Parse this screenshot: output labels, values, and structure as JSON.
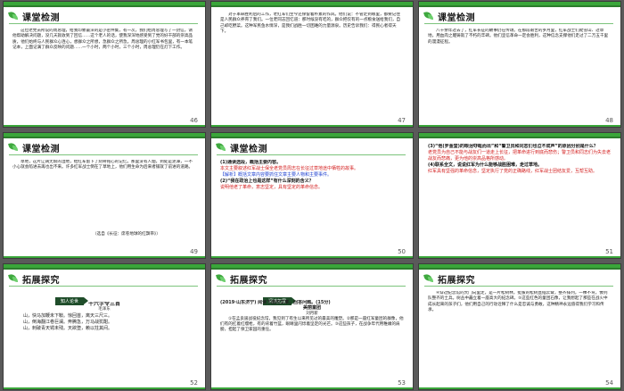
{
  "slides": [
    {
      "title": "课堂检测",
      "page": "46",
      "text": "这位老党员所说的周总理，给我印象最深的是小密件集，有一次，我们给周总理写了一封信，请他帮助解决问题，没几天就收到了回信……这个老人的话，使我深深地感受到了党的好干部的崇高品质，他们始终与人民群众心连心，想群众之所想，急群众之所急。周总理的小红军书包里，有一本笔记本，上面记满了群众反映的问题……一个小时，两个小时，三个小时，周总理仍在灯下工作。"
    },
    {
      "title": "",
      "page": "47",
      "text": "对于革命胜利后的工作，老红军们至今还保留着朴素的作风。他们说：不管走到哪里，都要记住是人民群众养育了我们。一位老同志回忆道：那时候没有吃的，群众把仅有的一点粮食送给我们，自己却吃野菜。这种军民鱼水情深，是我们战胜一切困难的力量源泉。历史告诉我们：得民心者得天下。"
    },
    {
      "title": "课堂检测",
      "page": "48",
      "text": "八十余年过去了，红军长征的故事仍在传颂。在那段艰苦的岁月里，红军战士们爬雪山、过草地，用血肉之躯铸就了不朽的丰碑。他们坚信革命一定会胜利，这种信念支撑他们走过了二万五千里的漫漫征程。"
    },
    {
      "title": "课堂检测",
      "page": "49",
      "text": "草地，这片辽阔无垠的湿地，给红军留下了刻骨铭心的记忆。那里没有人烟，到处是泥潭，一不小心就会陷进去再也出不来。许多红军战士倒在了草地上，他们用生命为后来者铺就了前进的道路。",
      "source": "（选自《长征：席卷地球的红飘带》）"
    },
    {
      "title": "课堂检测",
      "page": "50",
      "q1": "(1)通读选段，概括主要内容。",
      "a1": "本文主要叙述红军战士保全老党员周志在长征过草地途中牺牲的故事。",
      "a1b": "【解析】概括文章内容要抓住文章主要人物和主要事件。",
      "q2": "(2)“我在政治上也是这样”有什么深刻的含义？",
      "a2": "说明他老了革命，意志坚定，具有坚定的革命信念。"
    },
    {
      "title": "",
      "page": "51",
      "q3": "(3)“他(罗金堂)的眼泪夺眶而出”和“警卫员和同志们也泣不成声”的原因分别是什么？",
      "a3": "老党员为自己不能与战友们一道走上长征，把革命进行到底而悲伤；警卫员和同志们为失去老战友而悲痛，更为他的崇高品格所感动。",
      "q4": "(4)联系全文，说说红军为什么能够战胜困难，走过草地。",
      "a4": "红军具有坚强的革命信念，坚定执行了党的正确路线，红军战士团结友爱，互帮互助。"
    },
    {
      "title": "拓展探究",
      "page": "52",
      "banner": "知人论世",
      "poem_title": "十六字令三首",
      "poem_author": "毛泽东",
      "lines": [
        "山，快马加鞭未下鞍。惊回首，离天三尺三。",
        "山，倒海翻江卷巨澜。奔腾急，万马战犹酣。",
        "山，刺破青天锷未残。天欲堕，赖以拄其间。"
      ]
    },
    {
      "title": "拓展探究",
      "page": "53",
      "banner": "阅读拓展",
      "question": "(2019·山东济宁) 阅读下面的文章，回答问题。(15分)",
      "art_title": "美丽童团",
      "art_author": "刘月新",
      "text": "①在孟良崮战役纪念馆，我见到了有生以来所见过的最美的雕塑。②那是一座红军童团的群像，他们有的扛着红缨枪，有的背着竹篮，眼睛里闪烁着坚定的光芒。③这些孩子，在战争年代用稚嫩的肩膀，担起了保卫家园的重任。"
    },
    {
      "title": "拓展探究",
      "page": "54",
      "text": "④穿过纪念馆的大门向里走，是一片松树林，挺拔的松树直插云霄，整齐排列，一棵不弯，像列队整齐的士兵。树丛中矗立着一座高大的纪念碑。⑤这些红色的童团石像，让我想起了那些在战火中成长起来的孩子们，他们用自己的行动诠释了什么是忠诚与勇敢，这种精神永远值得我们学习和传承。"
    }
  ]
}
